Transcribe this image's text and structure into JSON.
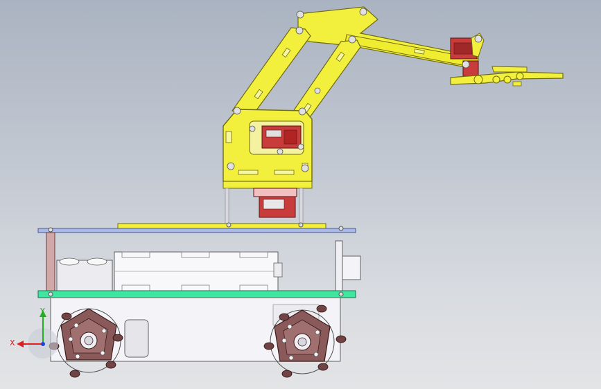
{
  "viewport": {
    "background_top": "#aab3c1",
    "background_bottom": "#e3e4e6"
  },
  "colors": {
    "arm_yellow": "#f2f03c",
    "arm_outline": "#6e6a10",
    "servo_red": "#c83c3c",
    "servo_dark": "#7a1c1c",
    "top_plate": "#aab9e6",
    "bottom_plate": "#3ee6a0",
    "chassis_white": "#f4f4f8",
    "wheel_brown": "#8a5a5a",
    "screw_gray": "#d0d0d0",
    "axis_x": "#e02020",
    "axis_y": "#20b020",
    "axis_z": "#2040e0"
  },
  "axis_triad": {
    "x_label": "X",
    "y_label": "Y"
  }
}
